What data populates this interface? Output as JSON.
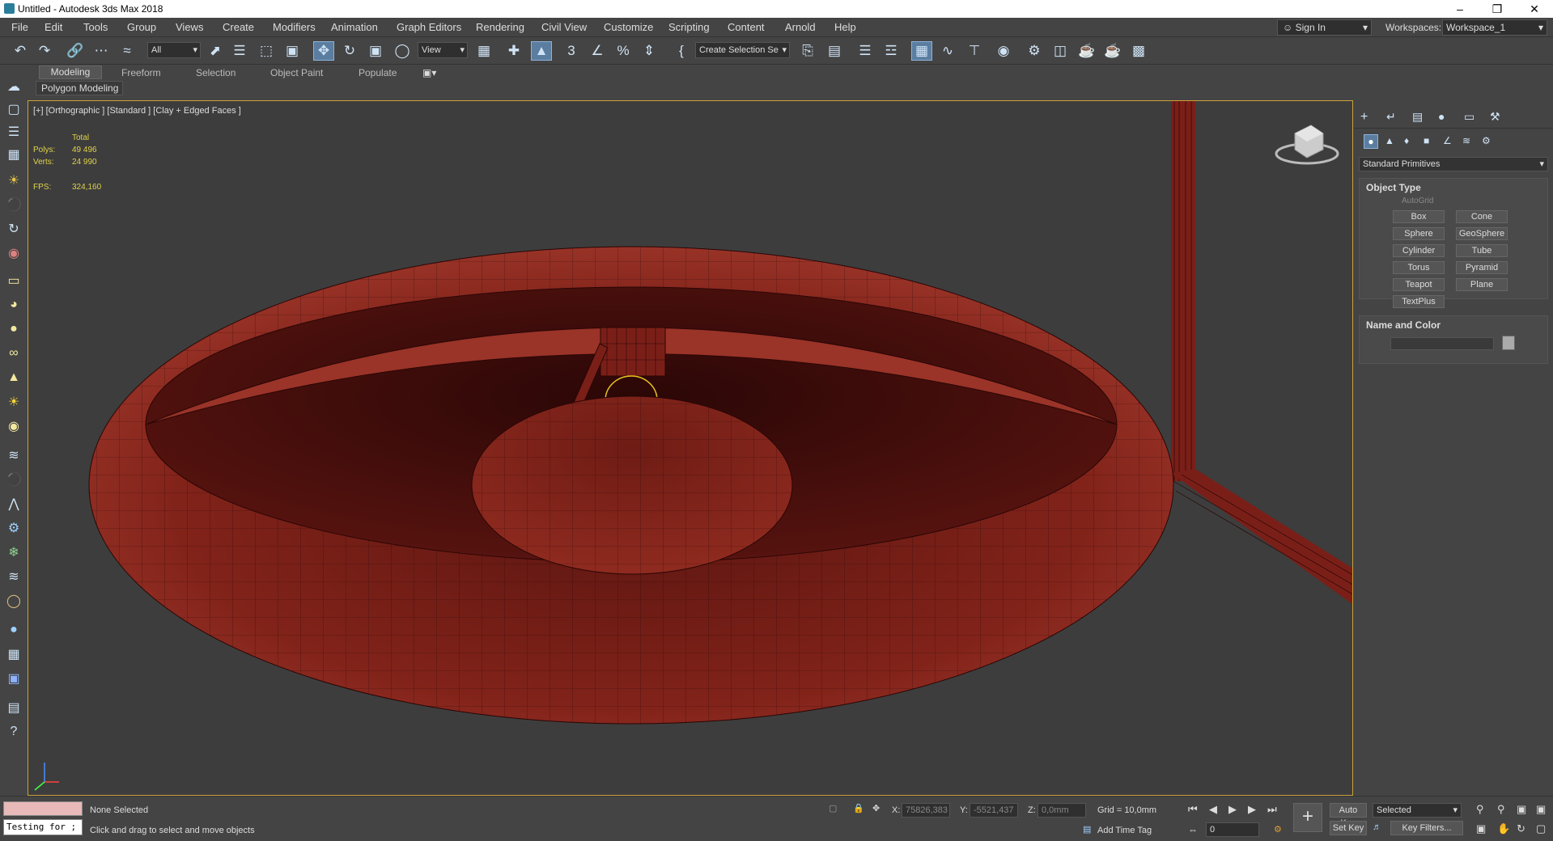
{
  "window": {
    "title": "Untitled - Autodesk 3ds Max 2018"
  },
  "menus": [
    "File",
    "Edit",
    "Tools",
    "Group",
    "Views",
    "Create",
    "Modifiers",
    "Animation",
    "Graph Editors",
    "Rendering",
    "Civil View",
    "Customize",
    "Scripting",
    "Content",
    "Arnold",
    "Help"
  ],
  "header": {
    "sign_in": "Sign In",
    "workspaces_label": "Workspaces:",
    "workspace_value": "Workspace_1"
  },
  "toolbar": {
    "filter_value": "All",
    "ref_coord_value": "View",
    "selection_set_value": "Create Selection Se"
  },
  "ribbon": {
    "tabs": [
      "Modeling",
      "Freeform",
      "Selection",
      "Object Paint",
      "Populate"
    ],
    "panel": "Polygon Modeling"
  },
  "viewport": {
    "label": "[+] [Orthographic ] [Standard ] [Clay + Edged Faces ]",
    "stats": {
      "total_label": "Total",
      "polys_label": "Polys:",
      "polys": "49 496",
      "verts_label": "Verts:",
      "verts": "24 990",
      "fps_label": "FPS:",
      "fps": "324,160"
    }
  },
  "command_panel": {
    "category": "Standard Primitives",
    "rollout1": "Object Type",
    "autogrid": "AutoGrid",
    "buttons": [
      "Box",
      "Cone",
      "Sphere",
      "GeoSphere",
      "Cylinder",
      "Tube",
      "Torus",
      "Pyramid",
      "Teapot",
      "Plane",
      "TextPlus"
    ],
    "rollout2": "Name and Color"
  },
  "status": {
    "script_text": "Testing for ;",
    "selection": "None Selected",
    "prompt": "Click and drag to select and move objects",
    "x_label": "X:",
    "x": "75826,383",
    "y_label": "Y:",
    "y": "-5521,437",
    "z_label": "Z:",
    "z": "0,0mm",
    "grid": "Grid = 10,0mm",
    "add_time_tag": "Add Time Tag",
    "auto_key": "Auto Key",
    "selected": "Selected",
    "set_key": "Set Key",
    "key_filters": "Key Filters...",
    "frame": "0"
  }
}
